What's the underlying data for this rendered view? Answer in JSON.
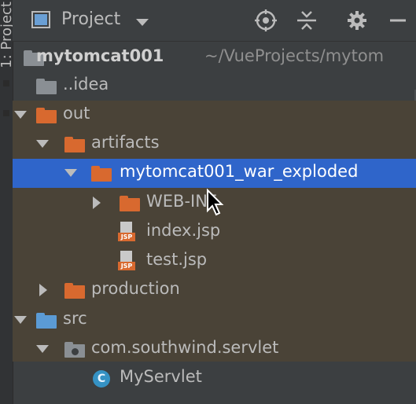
{
  "side_tab": {
    "label": "1: Project"
  },
  "toolbar": {
    "title": "Project",
    "icons": [
      "project-view-icon",
      "locate-icon",
      "collapse-icon",
      "gear-icon",
      "minimize-icon"
    ]
  },
  "tree": {
    "root": {
      "name": "mytomcat001",
      "path": "~/VueProjects/mytom"
    },
    "idea": "..idea",
    "out": "out",
    "artifacts": "artifacts",
    "exploded": "mytomcat001_war_exploded",
    "webinf": "WEB-INF",
    "index_jsp": "index.jsp",
    "test_jsp": "test.jsp",
    "production": "production",
    "src": "src",
    "package": "com.southwind.servlet",
    "servlet": "MyServlet",
    "jsp_badge": "JSP",
    "class_badge": "C"
  },
  "colors": {
    "background": "#3c3f41",
    "selection": "#2f65ca",
    "folder_orange": "#d8692f",
    "folder_blue": "#5b9bd5"
  }
}
